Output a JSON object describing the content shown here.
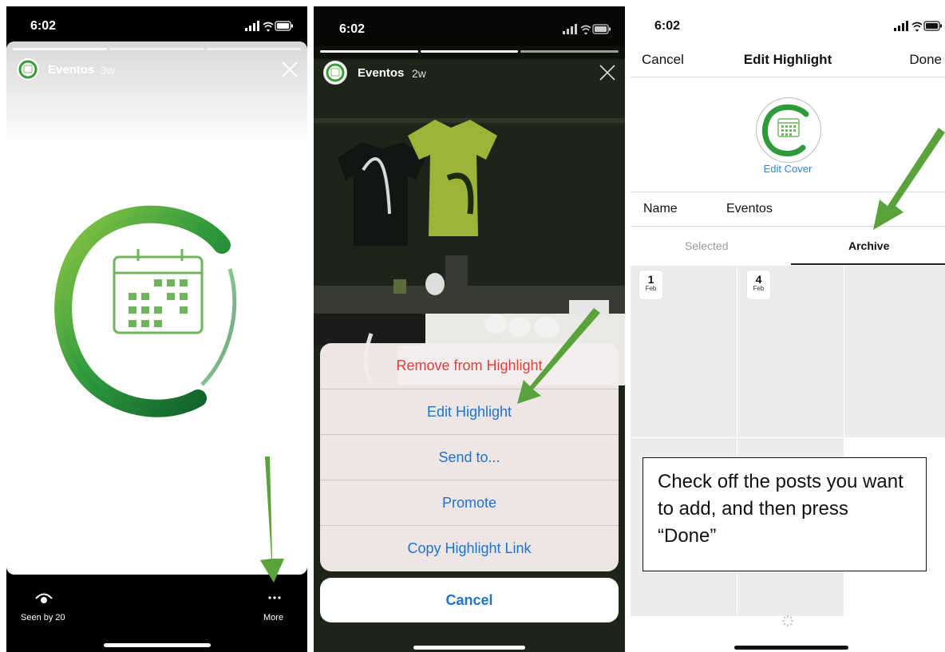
{
  "panels": {
    "story": {
      "time": "6:02",
      "account_name": "Eventos",
      "age": "3w",
      "seen_label": "Seen by 20",
      "more_label": "More"
    },
    "action_sheet": {
      "time": "6:02",
      "account_name": "Eventos",
      "age": "2w",
      "items": [
        "Remove from Highlight",
        "Edit Highlight",
        "Send to...",
        "Promote",
        "Copy Highlight Link"
      ],
      "cancel_label": "Cancel"
    },
    "edit_highlight": {
      "time": "6:02",
      "cancel_label": "Cancel",
      "title": "Edit Highlight",
      "done_label": "Done",
      "edit_cover_label": "Edit Cover",
      "name_label": "Name",
      "name_value": "Eventos",
      "tabs": [
        "Selected",
        "Archive"
      ],
      "active_tab": "Archive",
      "archive_items": [
        {
          "day": "1",
          "month": "Feb"
        },
        {
          "day": "4",
          "month": "Feb"
        }
      ],
      "instruction_note": "Check off the posts you want to add, and then press “Done”"
    }
  },
  "colors": {
    "brand_green": "#3a9a3a",
    "annotation_arrow": "#5aa23a",
    "ios_blue": "#1f73cf",
    "destructive_red": "#e0403a"
  }
}
